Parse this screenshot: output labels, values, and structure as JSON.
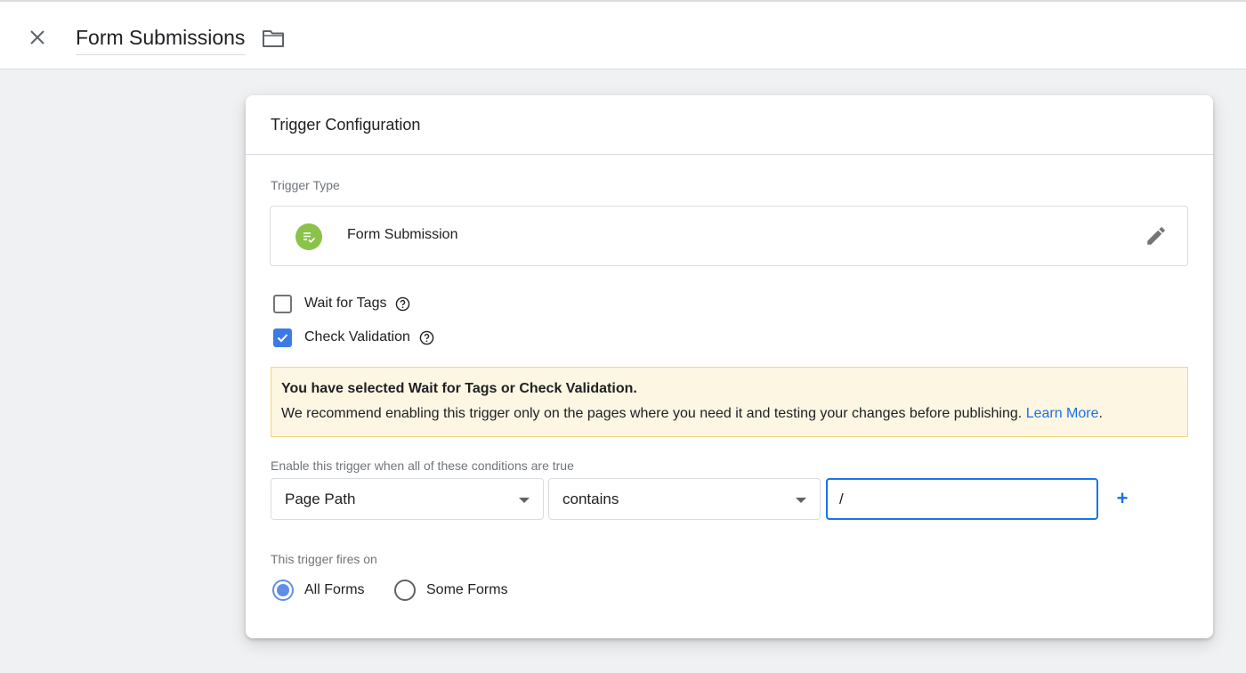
{
  "header": {
    "title": "Form Submissions",
    "close_icon": "close-icon",
    "folder_icon": "folder-icon"
  },
  "card": {
    "title": "Trigger Configuration",
    "trigger_type": {
      "label": "Trigger Type",
      "name": "Form Submission",
      "icon": "form-submission-icon",
      "icon_color": "#8bc34a",
      "edit_icon": "pencil-icon"
    },
    "options": [
      {
        "label": "Wait for Tags",
        "checked": false
      },
      {
        "label": "Check Validation",
        "checked": true
      }
    ],
    "notice": {
      "title": "You have selected Wait for Tags or Check Validation.",
      "body": "We recommend enabling this trigger only on the pages where you need it and testing your changes before publishing.",
      "link": "Learn More",
      "link_suffix": "."
    },
    "conditions": {
      "label": "Enable this trigger when all of these conditions are true",
      "variable": "Page Path",
      "operator": "contains",
      "value": "/",
      "add_label": "+"
    },
    "fires_on": {
      "label": "This trigger fires on",
      "options": [
        {
          "label": "All Forms",
          "selected": true
        },
        {
          "label": "Some Forms",
          "selected": false
        }
      ]
    }
  },
  "colors": {
    "accent": "#1a73e8",
    "checkbox": "#3b7be8",
    "notice_bg": "#fdf6e3",
    "notice_border": "#f5d77b"
  }
}
